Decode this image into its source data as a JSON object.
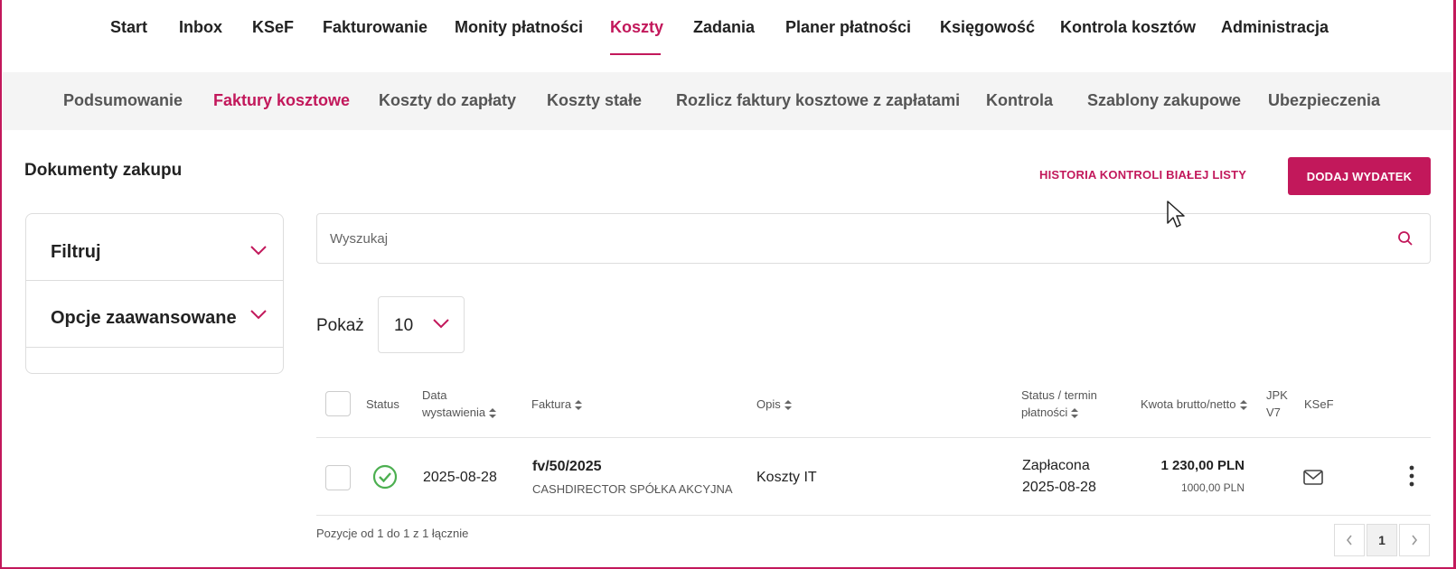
{
  "top_nav": [
    {
      "label": "Start",
      "active": false
    },
    {
      "label": "Inbox",
      "active": false
    },
    {
      "label": "KSeF",
      "active": false
    },
    {
      "label": "Fakturowanie",
      "active": false
    },
    {
      "label": "Monity płatności",
      "active": false
    },
    {
      "label": "Koszty",
      "active": true
    },
    {
      "label": "Zadania",
      "active": false
    },
    {
      "label": "Planer płatności",
      "active": false
    },
    {
      "label": "Księgowość",
      "active": false
    },
    {
      "label": "Kontrola kosztów",
      "active": false
    },
    {
      "label": "Administracja",
      "active": false
    }
  ],
  "sub_nav": [
    {
      "label": "Podsumowanie",
      "active": false
    },
    {
      "label": "Faktury kosztowe",
      "active": true
    },
    {
      "label": "Koszty do zapłaty",
      "active": false
    },
    {
      "label": "Koszty stałe",
      "active": false
    },
    {
      "label": "Rozlicz faktury kosztowe z zapłatami",
      "active": false
    },
    {
      "label": "Kontrola",
      "active": false
    },
    {
      "label": "Szablony zakupowe",
      "active": false
    },
    {
      "label": "Ubezpieczenia",
      "active": false
    }
  ],
  "page": {
    "title": "Dokumenty zakupu",
    "history_link": "HISTORIA KONTROLI BIAŁEJ LISTY",
    "add_button": "DODAJ WYDATEK"
  },
  "filters": {
    "filter_label": "Filtruj",
    "advanced_label": "Opcje zaawansowane"
  },
  "search": {
    "placeholder": "Wyszukaj",
    "value": ""
  },
  "page_size": {
    "label": "Pokaż",
    "value": "10"
  },
  "table": {
    "headers": {
      "status": "Status",
      "date_line1": "Data",
      "date_line2": "wystawienia",
      "invoice": "Faktura",
      "description": "Opis",
      "status_term_line1": "Status / termin",
      "status_term_line2": "płatności",
      "amount": "Kwota brutto/netto",
      "jpk_line1": "JPK",
      "jpk_line2": "V7",
      "ksef": "KSeF"
    },
    "rows": [
      {
        "status_icon": "check-circle-icon",
        "date": "2025-08-28",
        "invoice_number": "fv/50/2025",
        "counterparty": "CASHDIRECTOR SPÓŁKA AKCYJNA",
        "description": "Koszty IT",
        "payment_status": "Zapłacona",
        "payment_date": "2025-08-28",
        "gross": "1 230,00 PLN",
        "net": "1000,00 PLN",
        "ksef_icon": "envelope-icon",
        "menu_icon": "more-vertical-icon"
      }
    ],
    "footer": "Pozycje od 1 do 1 z 1 łącznie"
  },
  "pagination": {
    "current": "1"
  },
  "colors": {
    "accent": "#c2185b",
    "success": "#4caf50",
    "subnav_bg": "#f4f4f4"
  }
}
